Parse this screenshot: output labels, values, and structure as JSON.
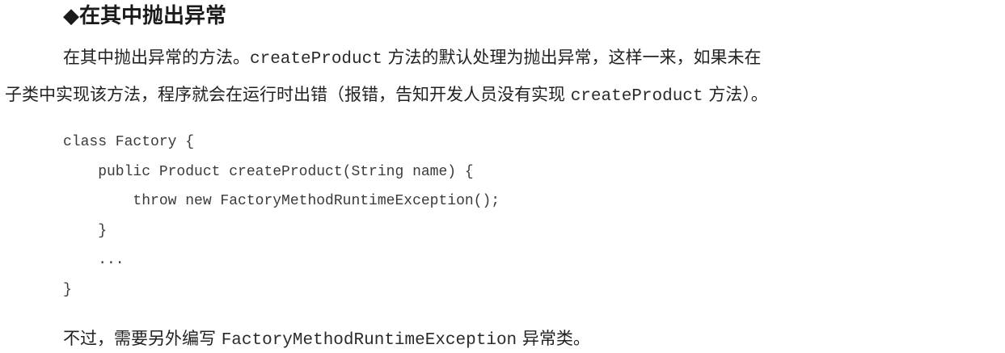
{
  "heading": "◆在其中抛出异常",
  "paragraph1": {
    "text_a": "在其中抛出异常的方法。",
    "code_a": "createProduct",
    "text_b": " 方法的默认处理为抛出异常，这样一来，如果未在"
  },
  "paragraph2": {
    "text_a": "子类中实现该方法，程序就会在运行时出错（报错，告知开发人员没有实现 ",
    "code_a": "createProduct",
    "text_b": " 方法）。"
  },
  "code_block": {
    "lines": [
      "class Factory {",
      "    public Product createProduct(String name) {",
      "        throw new FactoryMethodRuntimeException();",
      "    }",
      "    ...",
      "}"
    ]
  },
  "paragraph3": {
    "text_a": "不过，需要另外编写 ",
    "code_a": "FactoryMethodRuntimeException",
    "text_b": " 异常类。"
  }
}
